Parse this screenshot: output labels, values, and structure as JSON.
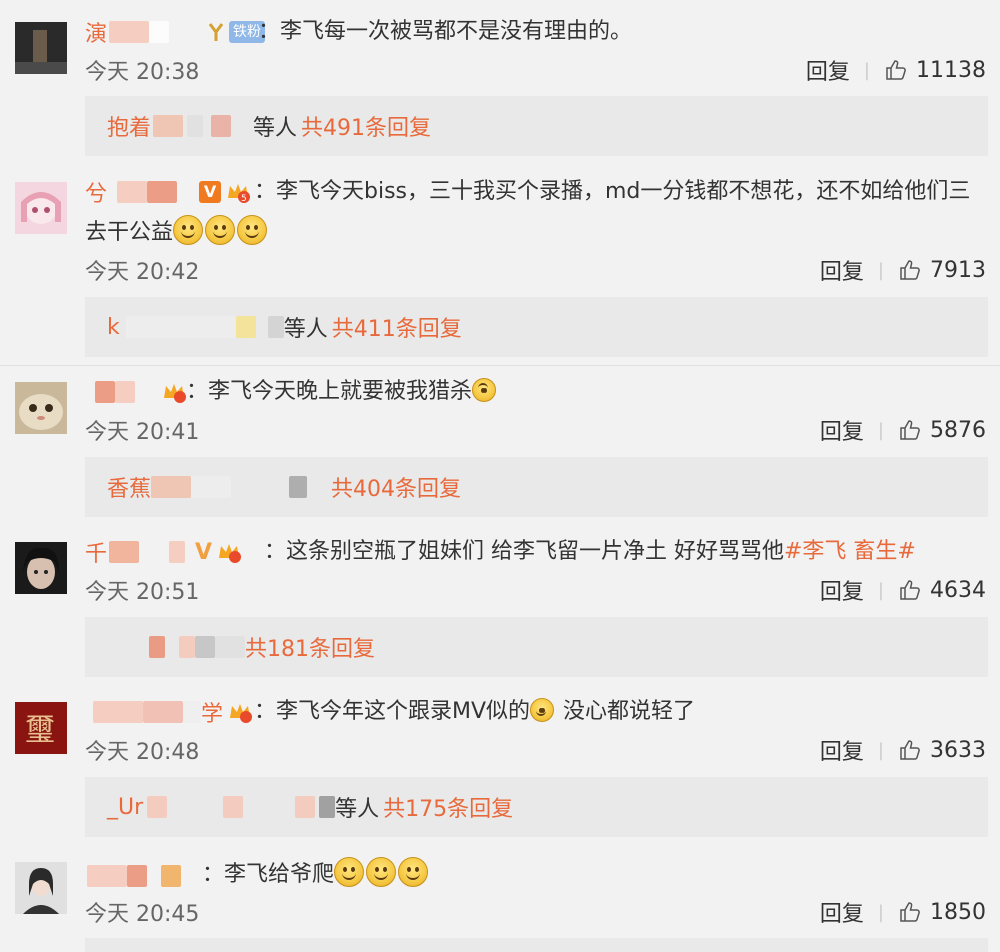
{
  "comments": [
    {
      "name_visible": "演",
      "badge": "铁粉",
      "text": "：李飞每一次被骂都不是没有理由的。",
      "time": "今天 20:38",
      "reply_label": "回复",
      "likes": "11138",
      "replies_prefix": "抱着",
      "replies_suffix": "等人",
      "replies_count": "共491条回复"
    },
    {
      "name_visible": "兮",
      "text": "：李飞今天biss，三十我买个录播，md一分钱都不想花，还不如给他们三",
      "text2": "去干公益",
      "time": "今天 20:42",
      "reply_label": "回复",
      "likes": "7913",
      "replies_prefix": "k",
      "replies_suffix": "等人",
      "replies_count": "共411条回复"
    },
    {
      "text": "：李飞今天晚上就要被我猎杀",
      "time": "今天 20:41",
      "reply_label": "回复",
      "likes": "5876",
      "replies_prefix": "香蕉",
      "replies_count": "共404条回复"
    },
    {
      "name_visible": "千",
      "text": "：这条别空瓶了姐妹们 给李飞留一片净土 好好骂骂他",
      "hashtag": "#李飞 畜生#",
      "time": "今天 20:51",
      "reply_label": "回复",
      "likes": "4634",
      "replies_count": "共181条回复"
    },
    {
      "name_visible": "学",
      "text": "：李飞今年这个跟录MV似的",
      "text_after": " 没心都说轻了",
      "time": "今天 20:48",
      "reply_label": "回复",
      "likes": "3633",
      "replies_prefix": "_Ur",
      "replies_suffix": "等人",
      "replies_count": "共175条回复"
    },
    {
      "text": "：李飞给爷爬",
      "time": "今天 20:45",
      "reply_label": "回复",
      "likes": "1850"
    }
  ],
  "colors": {
    "accent": "#e86a3c",
    "background": "#f2f2f2",
    "reply_box": "#e9e9e9"
  }
}
